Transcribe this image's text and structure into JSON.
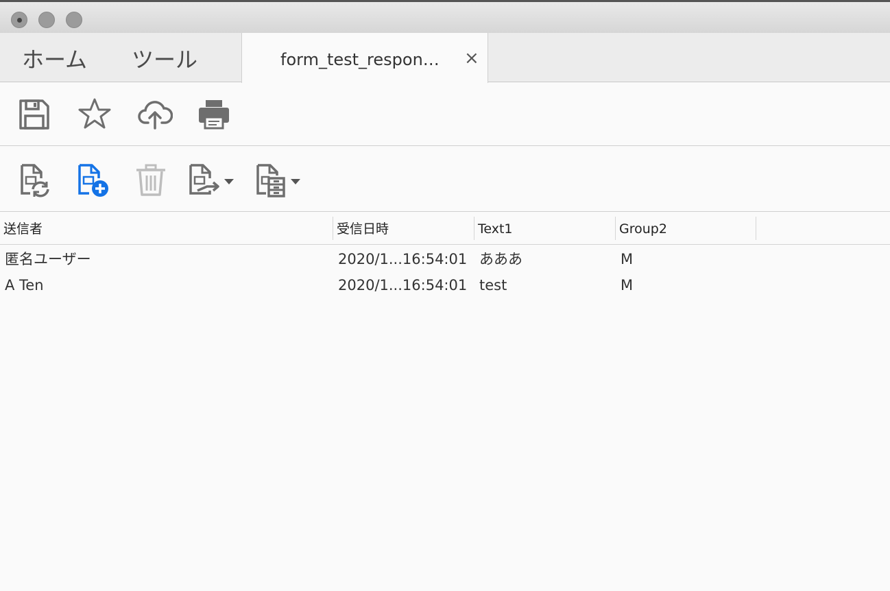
{
  "tabs": {
    "home": "ホーム",
    "tools": "ツール",
    "document": "form_test_respon…",
    "close": "×"
  },
  "toolbar_top": {
    "icons": [
      "save-icon",
      "star-icon",
      "cloud-upload-icon",
      "print-icon"
    ]
  },
  "toolbar_bottom": {
    "icons": [
      "refresh-file-icon",
      "add-file-icon",
      "trash-icon",
      "export-file-icon",
      "file-cabinet-icon"
    ],
    "accent": "#1473e6"
  },
  "table": {
    "columns": [
      "送信者",
      "受信日時",
      "Text1",
      "Group2"
    ],
    "rows": [
      [
        "匿名ユーザー",
        "2020/1...16:54:01",
        "あああ",
        "M"
      ],
      [
        "A Ten",
        "2020/1...16:54:01",
        "test",
        "M"
      ]
    ]
  }
}
